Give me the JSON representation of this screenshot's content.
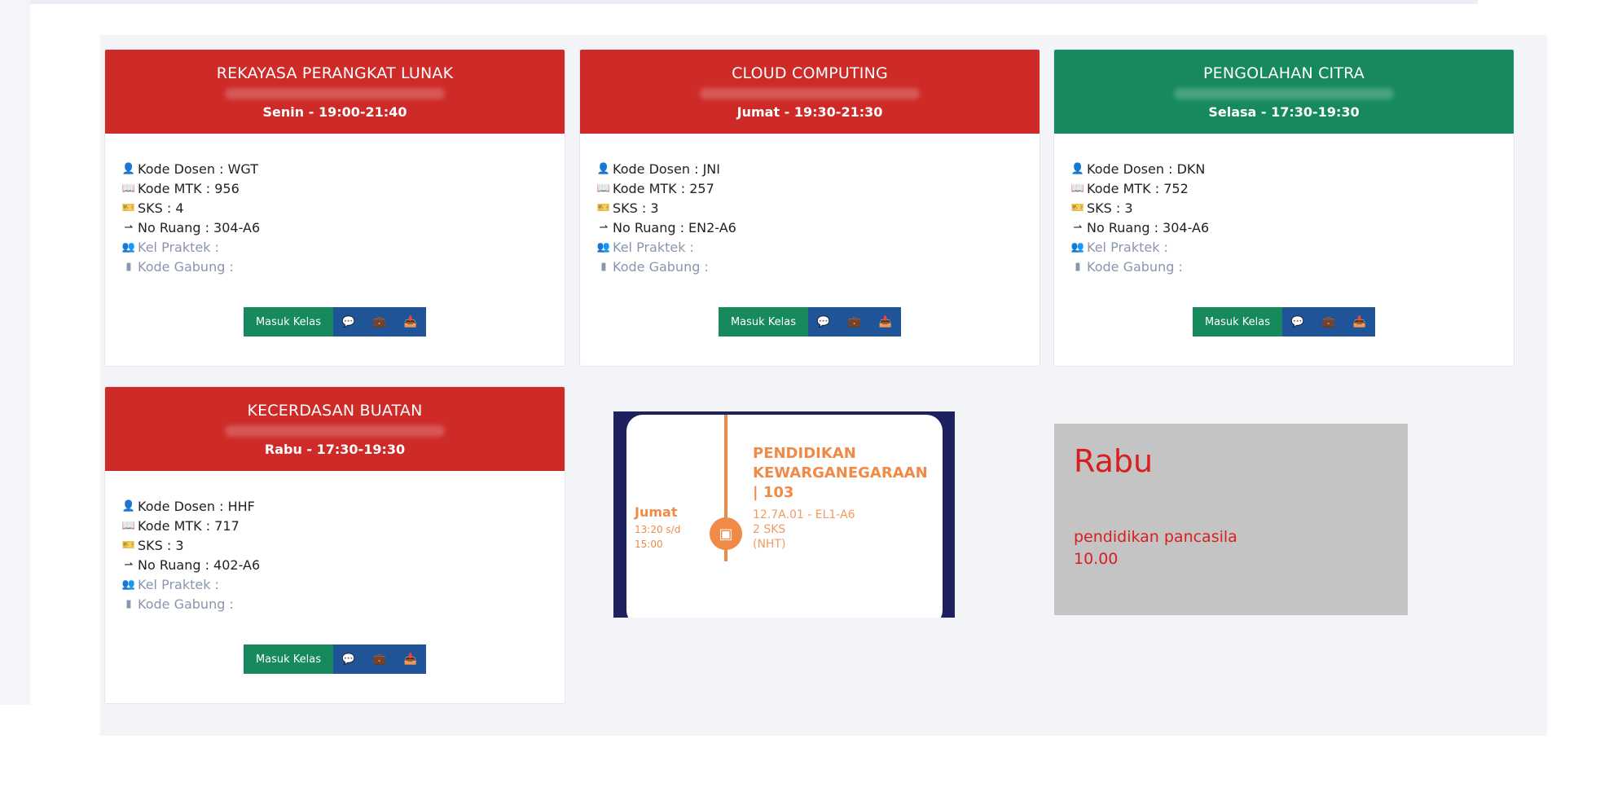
{
  "cards": [
    {
      "title": "REKAYASA PERANGKAT LUNAK",
      "schedule": "Senin - 19:00-21:40",
      "color": "#cd2a28",
      "kode_dosen": "Kode Dosen : WGT",
      "kode_mtk": "Kode MTK : 956",
      "sks": "SKS : 4",
      "no_ruang": "No Ruang : 304-A6",
      "kel_praktek": "Kel Praktek :",
      "kode_gabung": "Kode Gabung :",
      "button_label": "Masuk Kelas"
    },
    {
      "title": "CLOUD COMPUTING",
      "schedule": "Jumat - 19:30-21:30",
      "color": "#cd2a28",
      "kode_dosen": "Kode Dosen : JNI",
      "kode_mtk": "Kode MTK : 257",
      "sks": "SKS : 3",
      "no_ruang": "No Ruang : EN2-A6",
      "kel_praktek": "Kel Praktek :",
      "kode_gabung": "Kode Gabung :",
      "button_label": "Masuk Kelas"
    },
    {
      "title": "PENGOLAHAN CITRA",
      "schedule": "Selasa - 17:30-19:30",
      "color": "#168a5c",
      "kode_dosen": "Kode Dosen : DKN",
      "kode_mtk": "Kode MTK : 752",
      "sks": "SKS : 3",
      "no_ruang": "No Ruang : 304-A6",
      "kel_praktek": "Kel Praktek :",
      "kode_gabung": "Kode Gabung :",
      "button_label": "Masuk Kelas"
    },
    {
      "title": "KECERDASAN BUATAN",
      "schedule": "Rabu - 17:30-19:30",
      "color": "#cd2a28",
      "kode_dosen": "Kode Dosen : HHF",
      "kode_mtk": "Kode MTK : 717",
      "sks": "SKS : 3",
      "no_ruang": "No Ruang : 402-A6",
      "kel_praktek": "Kel Praktek :",
      "kode_gabung": "Kode Gabung :",
      "button_label": "Masuk Kelas"
    }
  ],
  "promo": {
    "day": "Jumat",
    "time": "13:20 s/d 15:00",
    "title": "PENDIDIKAN KEWARGANEGARAAN | 103",
    "class_code": "12.7A.01 - EL1-A6",
    "sks": "2 SKS",
    "lecturer": "(NHT)",
    "accent": "#ef8a47"
  },
  "note_box": {
    "day": "Rabu",
    "course": "pendidikan pancasila",
    "time": "10.00",
    "color": "#d81e1e"
  }
}
